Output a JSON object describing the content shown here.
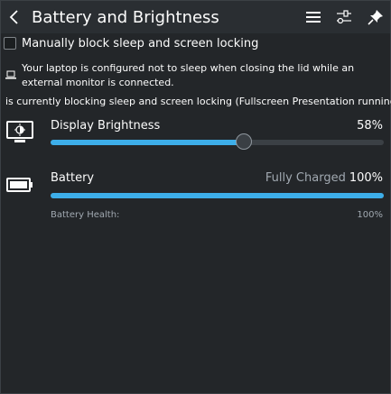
{
  "header": {
    "title": "Battery and Brightness",
    "icons": {
      "back": "chevron-left-icon",
      "menu": "hamburger-menu-icon",
      "configure": "settings-sliders-icon",
      "pin": "pin-icon"
    }
  },
  "inhibit": {
    "checkbox_label": "Manually block sleep and screen locking",
    "checked": false,
    "lid_info": "Your laptop is configured not to sleep when closing the lid while an external monitor is connected.",
    "blocking_info": "is currently blocking sleep and screen locking (Fullscreen Presentation running)"
  },
  "brightness": {
    "label": "Display Brightness",
    "value_text": "58%",
    "level": 0.58,
    "icon": "display-brightness-icon"
  },
  "battery": {
    "label": "Battery",
    "status": "Fully Charged",
    "value_text": "100%",
    "level": 1.0,
    "icon": "battery-icon",
    "health_label": "Battery Health:",
    "health_value": "100%"
  },
  "colors": {
    "accent": "#3daee9",
    "background": "#232629",
    "header_background": "#2a2e32",
    "text": "#fcfcfc",
    "muted_text": "#a1a9b1"
  }
}
